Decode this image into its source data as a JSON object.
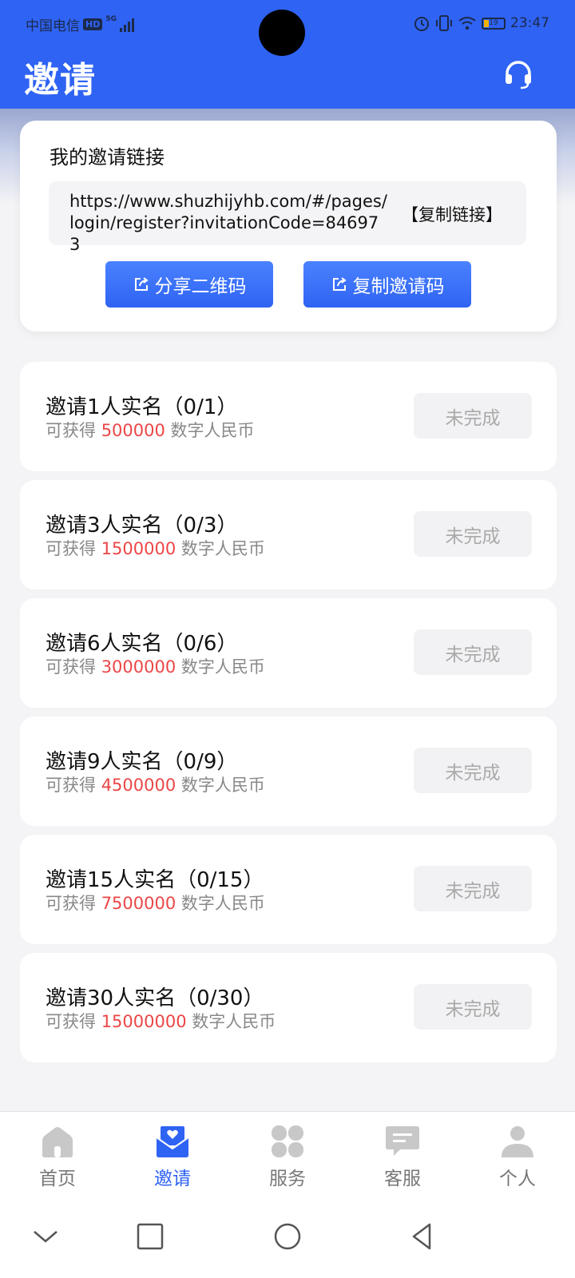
{
  "status_bar": {
    "carrier": "中国电信",
    "hd_badge": "HD",
    "network": "5G",
    "battery_level": "19",
    "time": "23:47"
  },
  "header": {
    "title": "邀请",
    "support_icon": "headset-icon"
  },
  "invite_card": {
    "title": "我的邀请链接",
    "link": "https://www.shuzhijyhb.com/#/pages/login/register?invitationCode=846973",
    "copy_link_label": "【复制链接】",
    "share_qr_label": "分享二维码",
    "copy_code_label": "复制邀请码",
    "button_icon": "share-icon"
  },
  "tasks": [
    {
      "title": "邀请1人实名（0/1）",
      "reward_prefix": "可获得",
      "amount": "500000",
      "reward_suffix": "数字人民币",
      "status": "未完成"
    },
    {
      "title": "邀请3人实名（0/3）",
      "reward_prefix": "可获得",
      "amount": "1500000",
      "reward_suffix": "数字人民币",
      "status": "未完成"
    },
    {
      "title": "邀请6人实名（0/6）",
      "reward_prefix": "可获得",
      "amount": "3000000",
      "reward_suffix": "数字人民币",
      "status": "未完成"
    },
    {
      "title": "邀请9人实名（0/9）",
      "reward_prefix": "可获得",
      "amount": "4500000",
      "reward_suffix": "数字人民币",
      "status": "未完成"
    },
    {
      "title": "邀请15人实名（0/15）",
      "reward_prefix": "可获得",
      "amount": "7500000",
      "reward_suffix": "数字人民币",
      "status": "未完成"
    },
    {
      "title": "邀请30人实名（0/30）",
      "reward_prefix": "可获得",
      "amount": "15000000",
      "reward_suffix": "数字人民币",
      "status": "未完成"
    }
  ],
  "tab_bar": [
    {
      "label": "首页",
      "icon": "home-icon",
      "active": false
    },
    {
      "label": "邀请",
      "icon": "invite-envelope-icon",
      "active": true
    },
    {
      "label": "服务",
      "icon": "services-grid-icon",
      "active": false
    },
    {
      "label": "客服",
      "icon": "chat-icon",
      "active": false
    },
    {
      "label": "个人",
      "icon": "person-icon",
      "active": false
    }
  ],
  "colors": {
    "primary": "#2f63f3",
    "reward_amount": "#ec4646",
    "tab_inactive": "#c8c8c8"
  }
}
